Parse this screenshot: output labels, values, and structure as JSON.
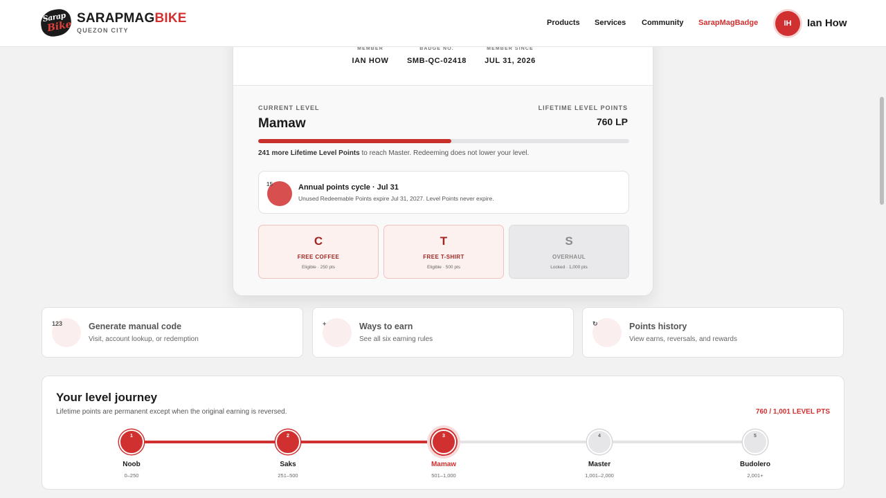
{
  "brand": {
    "name_part1": "SARAPMAG",
    "name_part2": "BIKE",
    "location": "QUEZON CITY",
    "logo_line1": "Sarap",
    "logo_line2": "Bike"
  },
  "nav": {
    "products": "Products",
    "services": "Services",
    "community": "Community",
    "badge": "SarapMagBadge"
  },
  "user": {
    "initials": "IH",
    "name": "Ian How"
  },
  "colors": {
    "accent": "#d0302f",
    "page_bg": "#f2f2f3",
    "reward_bg": "#fdf1ef",
    "locked_bg": "#e9e9eb"
  },
  "badge": {
    "member_label": "MEMBER",
    "member_value": "IAN HOW",
    "badge_no_label": "BADGE NO.",
    "badge_no_value": "SMB-QC-02418",
    "since_label": "MEMBER SINCE",
    "since_value": "JUL 31, 2026"
  },
  "level": {
    "current_label": "CURRENT LEVEL",
    "current_name": "Mamaw",
    "lifetime_label": "LIFETIME LEVEL POINTS",
    "lifetime_value": "760 LP",
    "progress_fraction": 0.52,
    "note_bold": "241 more Lifetime Level Points",
    "note_rest": " to reach Master. Redeeming does not lower your level."
  },
  "cycle": {
    "icon_text": "15",
    "title": "Annual points cycle · Jul 31",
    "subtitle": "Unused Redeemable Points expire Jul 31, 2027. Level Points never expire."
  },
  "rewards": [
    {
      "letter": "C",
      "name": "FREE COFFEE",
      "status": "Eligible · 250 pts"
    },
    {
      "letter": "T",
      "name": "FREE T-SHIRT",
      "status": "Eligible · 500 pts"
    },
    {
      "letter": "S",
      "name": "OVERHAUL",
      "status": "Locked · 1,000 pts"
    }
  ],
  "actions": [
    {
      "glyph": "123",
      "title": "Generate manual code",
      "subtitle": "Visit, account lookup, or redemption"
    },
    {
      "glyph": "+",
      "title": "Ways to earn",
      "subtitle": "See all six earning rules"
    },
    {
      "glyph": "↻",
      "title": "Points history",
      "subtitle": "View earns, reversals, and rewards"
    }
  ],
  "journey": {
    "title": "Your level journey",
    "subtitle": "Lifetime points are permanent except when the original earning is reversed.",
    "points_text": "760 / 1,001 LEVEL PTS",
    "steps": [
      {
        "num": "1",
        "name": "Noob",
        "range": "0–250"
      },
      {
        "num": "2",
        "name": "Saks",
        "range": "251–500"
      },
      {
        "num": "3",
        "name": "Mamaw",
        "range": "501–1,000"
      },
      {
        "num": "4",
        "name": "Master",
        "range": "1,001–2,000"
      },
      {
        "num": "5",
        "name": "Budolero",
        "range": "2,001+"
      }
    ]
  }
}
